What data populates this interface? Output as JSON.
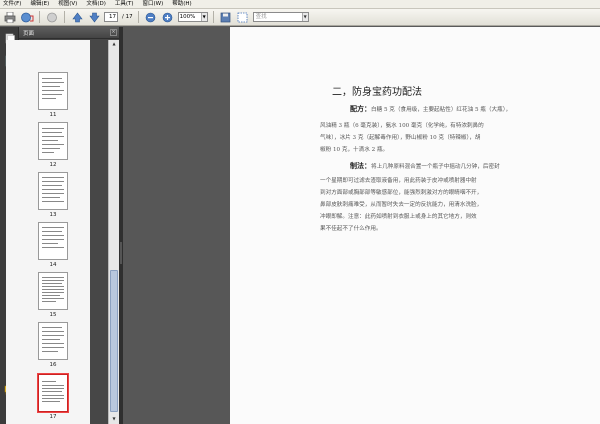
{
  "menubar": {
    "items": [
      "文件(F)",
      "编辑(E)",
      "视图(V)",
      "文档(D)",
      "工具(T)",
      "窗口(W)",
      "帮助(H)"
    ]
  },
  "toolbar": {
    "current_page": "17",
    "page_total": "/ 17",
    "zoom": "100%",
    "search_placeholder": "查找",
    "icons": [
      "print-icon",
      "email-icon",
      "globe-icon",
      "page-up-icon",
      "page-down-icon",
      "zoom-out-icon",
      "zoom-in-icon",
      "save-icon",
      "select-icon"
    ]
  },
  "panel": {
    "title": "页面",
    "close": "×"
  },
  "thumbnails": [
    {
      "label": "11"
    },
    {
      "label": "12"
    },
    {
      "label": "13"
    },
    {
      "label": "14"
    },
    {
      "label": "15"
    },
    {
      "label": "16"
    },
    {
      "label": "17",
      "selected": true
    }
  ],
  "document": {
    "heading": "二，防身宝药功配法",
    "formula_label": "配方：",
    "formula_text_1": "白糖 5 克（食用级，主要起粘性）红花油 5 瓶（大瓶），",
    "formula_text_2": "风油精 3 瓶（6 毫克装），氨水 100 毫克（化学纯，有特浓刺鼻的",
    "formula_text_3": "气味），冰片 3 克（起解毒作用），野山椒粉 10 克（特辣椒），胡",
    "formula_text_4": "椒粉 10 克，十滴水 2 瓶。",
    "method_label": "制法：",
    "method_text_1": "将上几种原料混合置一个瓶子中摇动几分钟，后密封",
    "method_text_2": "一个星期即可过滤去渣取液备用，用此药装于皮冲或喷射器中射",
    "method_text_3": "到对方面部或胸部部等敏感部位，能强烈刺激对方的眼睛咽不开，",
    "method_text_4": "鼻部皮肤刺痛难受，从而暂时失去一定的反抗能力，用清水洗脸，",
    "method_text_5": "冲眼即解。注意：此药如喷射到衣服上或身上的其它地方，则效",
    "method_text_6": "果不佳起不了什么作用。"
  },
  "colors": {
    "menubar_bg": "#f0efe8",
    "panel_bg": "#474747",
    "page_bg": "#fbfbfb",
    "selected_thumb": "#cc2222"
  }
}
